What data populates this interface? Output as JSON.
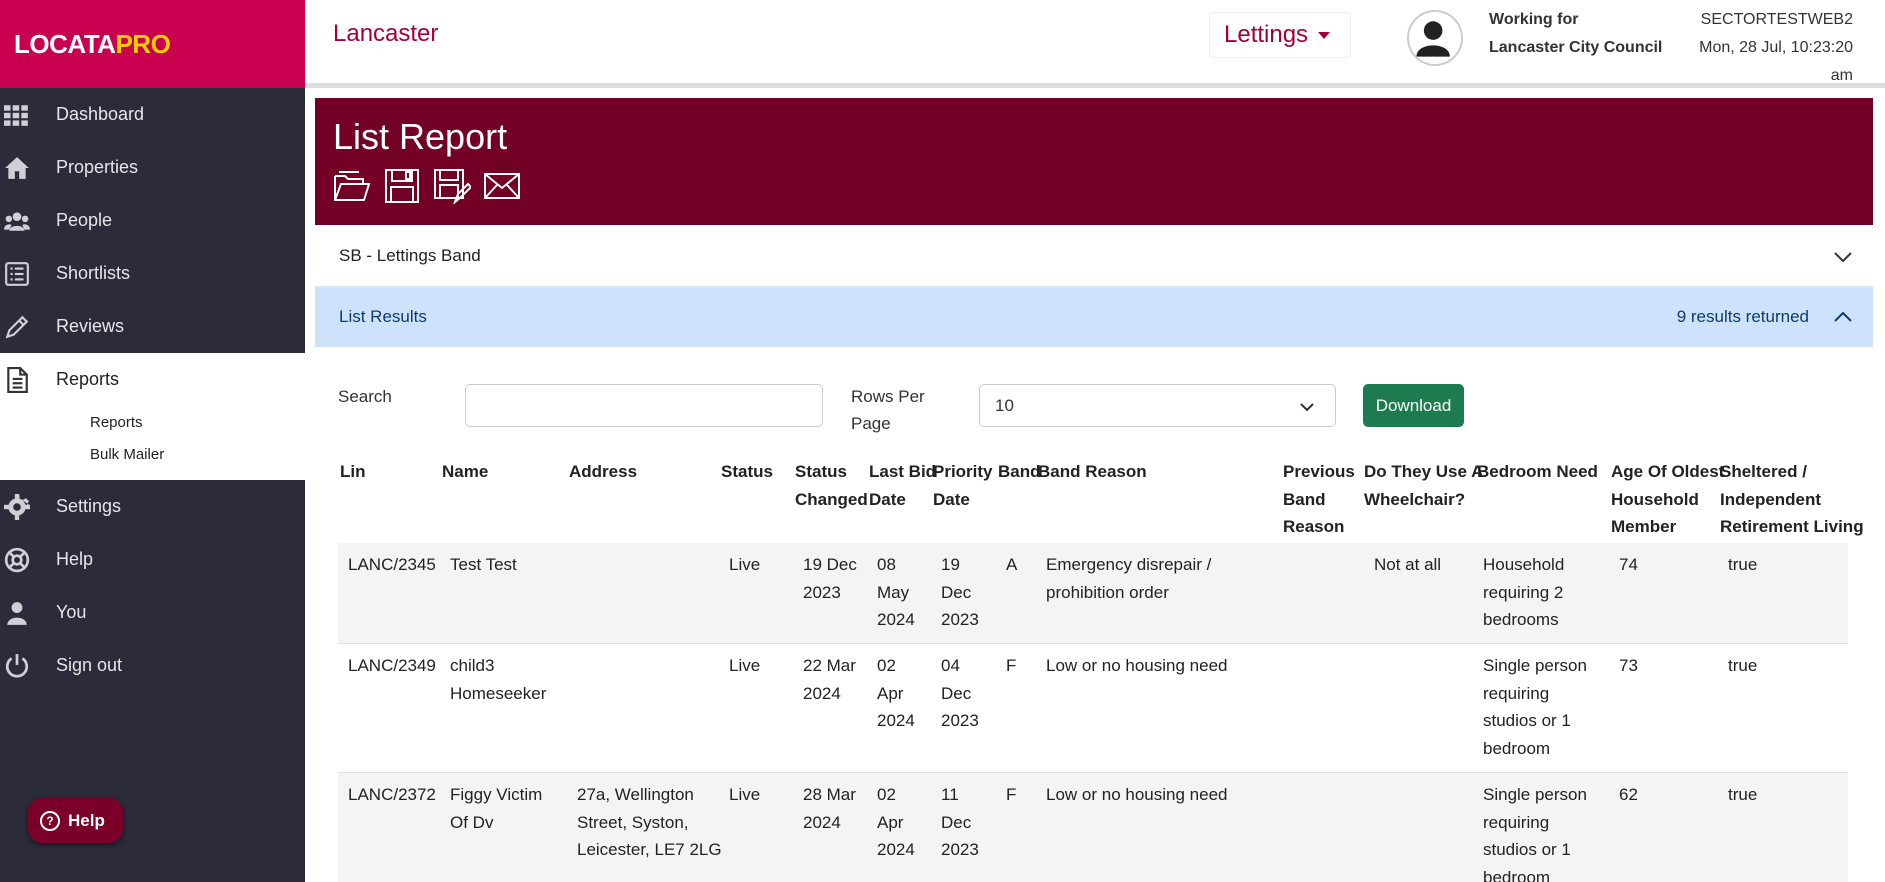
{
  "app": {
    "logo_main": "LOCATA",
    "logo_accent": "PRO",
    "brand": "Lancaster",
    "module": "Lettings"
  },
  "user": {
    "working_for_label": "Working for",
    "council": "Lancaster City Council",
    "username": "SECTORTESTWEB2",
    "datetime_line1": "Mon, 28 Jul, 10:23:20",
    "datetime_line2": "am"
  },
  "sidebar": {
    "items": [
      {
        "label": "Dashboard",
        "icon": "grid-icon"
      },
      {
        "label": "Properties",
        "icon": "home-icon"
      },
      {
        "label": "People",
        "icon": "people-icon"
      },
      {
        "label": "Shortlists",
        "icon": "list-icon"
      },
      {
        "label": "Reviews",
        "icon": "pencil-icon"
      },
      {
        "label": "Reports",
        "icon": "document-icon"
      },
      {
        "label": "Settings",
        "icon": "gear-icon"
      },
      {
        "label": "Help",
        "icon": "lifebuoy-icon"
      },
      {
        "label": "You",
        "icon": "user-icon"
      },
      {
        "label": "Sign out",
        "icon": "power-icon"
      }
    ],
    "sub_items": [
      {
        "label": "Reports"
      },
      {
        "label": "Bulk Mailer"
      }
    ],
    "help_button": "Help"
  },
  "page": {
    "title": "List Report",
    "section_label": "SB - Lettings Band",
    "results_label": "List Results",
    "results_count": "9 results returned"
  },
  "filters": {
    "search_label": "Search",
    "search_value": "",
    "rows_label_1": "Rows Per",
    "rows_label_2": "Page",
    "rows_value": "10",
    "download_label": "Download"
  },
  "table": {
    "headers": [
      {
        "lines": [
          "Lin"
        ]
      },
      {
        "lines": [
          "Name"
        ]
      },
      {
        "lines": [
          "Address"
        ]
      },
      {
        "lines": [
          "Status"
        ]
      },
      {
        "lines": [
          "Status",
          "Changed"
        ]
      },
      {
        "lines": [
          "Last Bid",
          "Date"
        ]
      },
      {
        "lines": [
          "Priority",
          "Date"
        ]
      },
      {
        "lines": [
          "Band"
        ]
      },
      {
        "lines": [
          "Band Reason"
        ]
      },
      {
        "lines": [
          "Previous",
          "Band",
          "Reason"
        ]
      },
      {
        "lines": [
          "Do They Use A",
          "Wheelchair?"
        ]
      },
      {
        "lines": [
          "Bedroom Need"
        ]
      },
      {
        "lines": [
          "Age Of Oldest",
          "Household",
          "Member"
        ]
      },
      {
        "lines": [
          "Sheltered /",
          "Independent",
          "Retirement Living"
        ]
      }
    ],
    "rows": [
      {
        "lin": [
          "LANC/2345"
        ],
        "name": [
          "Test Test"
        ],
        "address": [],
        "status": [
          "Live"
        ],
        "status_changed": [
          "19 Dec",
          "2023"
        ],
        "last_bid": [
          "08",
          "May",
          "2024"
        ],
        "priority": [
          "19",
          "Dec",
          "2023"
        ],
        "band": [
          "A"
        ],
        "band_reason": [
          "Emergency disrepair /",
          "prohibition order"
        ],
        "prev_band_reason": [],
        "wheelchair": [
          "Not at all"
        ],
        "bedroom_need": [
          "Household",
          "requiring 2",
          "bedrooms"
        ],
        "age_oldest": [
          "74"
        ],
        "sheltered": [
          "true"
        ]
      },
      {
        "lin": [
          "LANC/2349"
        ],
        "name": [
          "child3",
          "Homeseeker"
        ],
        "address": [],
        "status": [
          "Live"
        ],
        "status_changed": [
          "22 Mar",
          "2024"
        ],
        "last_bid": [
          "02",
          "Apr",
          "2024"
        ],
        "priority": [
          "04",
          "Dec",
          "2023"
        ],
        "band": [
          "F"
        ],
        "band_reason": [
          "Low or no housing need"
        ],
        "prev_band_reason": [],
        "wheelchair": [],
        "bedroom_need": [
          "Single person",
          "requiring",
          "studios or 1",
          "bedroom"
        ],
        "age_oldest": [
          "73"
        ],
        "sheltered": [
          "true"
        ]
      },
      {
        "lin": [
          "LANC/2372"
        ],
        "name": [
          "Figgy Victim",
          "Of Dv"
        ],
        "address": [
          "27a, Wellington",
          "Street, Syston,",
          "Leicester, LE7 2LG"
        ],
        "status": [
          "Live"
        ],
        "status_changed": [
          "28 Mar",
          "2024"
        ],
        "last_bid": [
          "02",
          "Apr",
          "2024"
        ],
        "priority": [
          "11",
          "Dec",
          "2023"
        ],
        "band": [
          "F"
        ],
        "band_reason": [
          "Low or no housing need"
        ],
        "prev_band_reason": [],
        "wheelchair": [],
        "bedroom_need": [
          "Single person",
          "requiring",
          "studios or 1",
          "bedroom"
        ],
        "age_oldest": [
          "62"
        ],
        "sheltered": [
          "true"
        ]
      }
    ]
  },
  "colors": {
    "logo_bg": "#c8004f",
    "sidebar_bg": "#2b2b3a",
    "banner_bg": "#730025",
    "brand_text": "#a3003a",
    "results_bar": "#cfe2fb",
    "download_bg": "#1e7b4f"
  }
}
